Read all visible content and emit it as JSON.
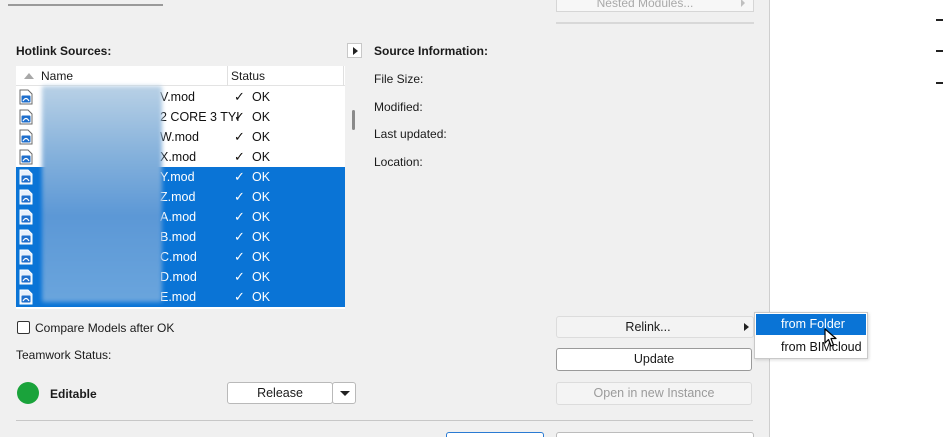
{
  "top": {
    "nested_modules_label": "Nested Modules..."
  },
  "hotlink_sources": {
    "title": "Hotlink Sources:",
    "columns": {
      "name": "Name",
      "status": "Status"
    },
    "rows": [
      {
        "name_visible": "V.mod",
        "status": "OK",
        "selected": false
      },
      {
        "name_visible": "2 CORE 3 TYI",
        "status": "OK",
        "selected": false
      },
      {
        "name_visible": "W.mod",
        "status": "OK",
        "selected": false
      },
      {
        "name_visible": "X.mod",
        "status": "OK",
        "selected": false
      },
      {
        "name_visible": "Y.mod",
        "status": "OK",
        "selected": true
      },
      {
        "name_visible": "Z.mod",
        "status": "OK",
        "selected": true
      },
      {
        "name_visible": "A.mod",
        "status": "OK",
        "selected": true
      },
      {
        "name_visible": "B.mod",
        "status": "OK",
        "selected": true
      },
      {
        "name_visible": "C.mod",
        "status": "OK",
        "selected": true
      },
      {
        "name_visible": "D.mod",
        "status": "OK",
        "selected": true
      },
      {
        "name_visible": "E.mod",
        "status": "OK",
        "selected": true
      }
    ],
    "check_glyph": "✓"
  },
  "source_info": {
    "title": "Source Information:",
    "labels": {
      "file_size": "File Size:",
      "modified": "Modified:",
      "last_updated": "Last updated:",
      "location": "Location:"
    }
  },
  "compare": {
    "label": "Compare Models after OK",
    "checked": false
  },
  "teamwork": {
    "label": "Teamwork Status:",
    "status": "Editable",
    "status_color": "#1aa33b",
    "release_label": "Release"
  },
  "buttons": {
    "relink": "Relink...",
    "update": "Update",
    "open_new_instance": "Open in new Instance"
  },
  "relink_menu": {
    "items": [
      {
        "label": "from Folder",
        "highlighted": true
      },
      {
        "label": "from BIMcloud",
        "highlighted": false
      }
    ]
  },
  "colors": {
    "selection": "#0a74d6",
    "dialog_bg": "#f0f0f0"
  }
}
